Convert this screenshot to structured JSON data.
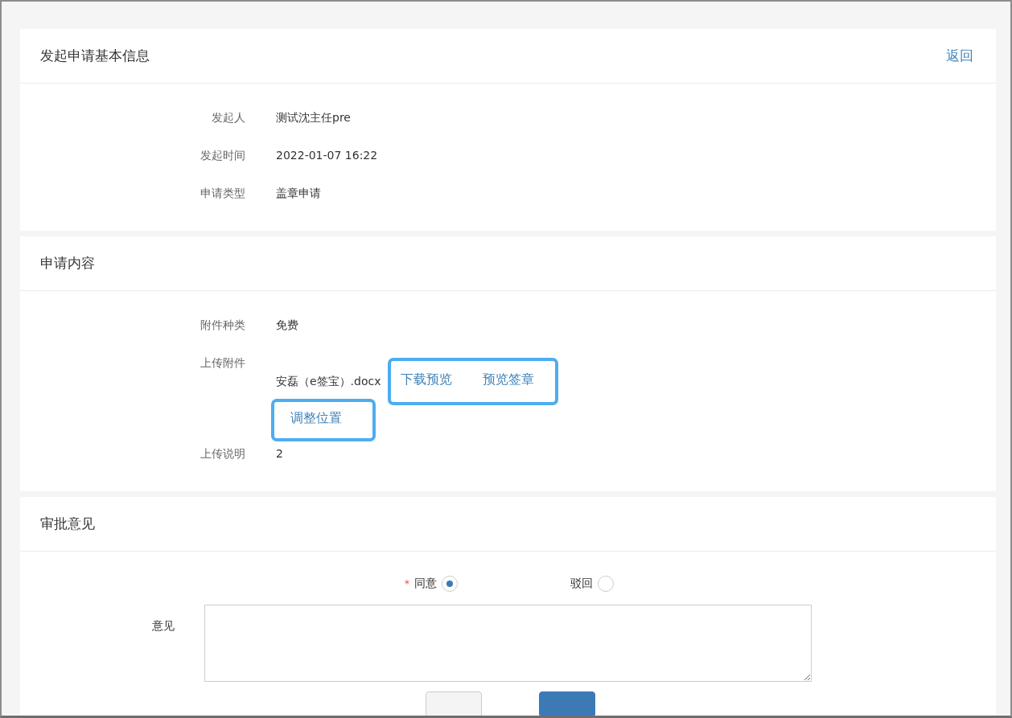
{
  "basic_info": {
    "title": "发起申请基本信息",
    "back_link": "返回",
    "fields": [
      {
        "label": "发起人",
        "value": "测试沈主任pre"
      },
      {
        "label": "发起时间",
        "value": "2022-01-07 16:22"
      },
      {
        "label": "申请类型",
        "value": "盖章申请"
      }
    ]
  },
  "content": {
    "title": "申请内容",
    "attachment_type": {
      "label": "附件种类",
      "value": "免费"
    },
    "attachment": {
      "label": "上传附件",
      "file_name": "安磊（e签宝）.docx",
      "action_groups": [
        {
          "highlighted": true,
          "links": [
            "下载预览",
            "预览签章"
          ]
        },
        {
          "highlighted": true,
          "links": [
            "调整位置"
          ]
        }
      ]
    },
    "note": {
      "label": "上传说明",
      "value": "2"
    }
  },
  "approval": {
    "title": "审批意见",
    "options": [
      {
        "required_mark": "*",
        "label": "同意",
        "selected": true
      },
      {
        "label": "驳回",
        "selected": false
      }
    ],
    "comment": {
      "label": "意见"
    },
    "buttons": [
      {
        "kind": "secondary"
      },
      {
        "kind": "primary"
      }
    ]
  }
}
